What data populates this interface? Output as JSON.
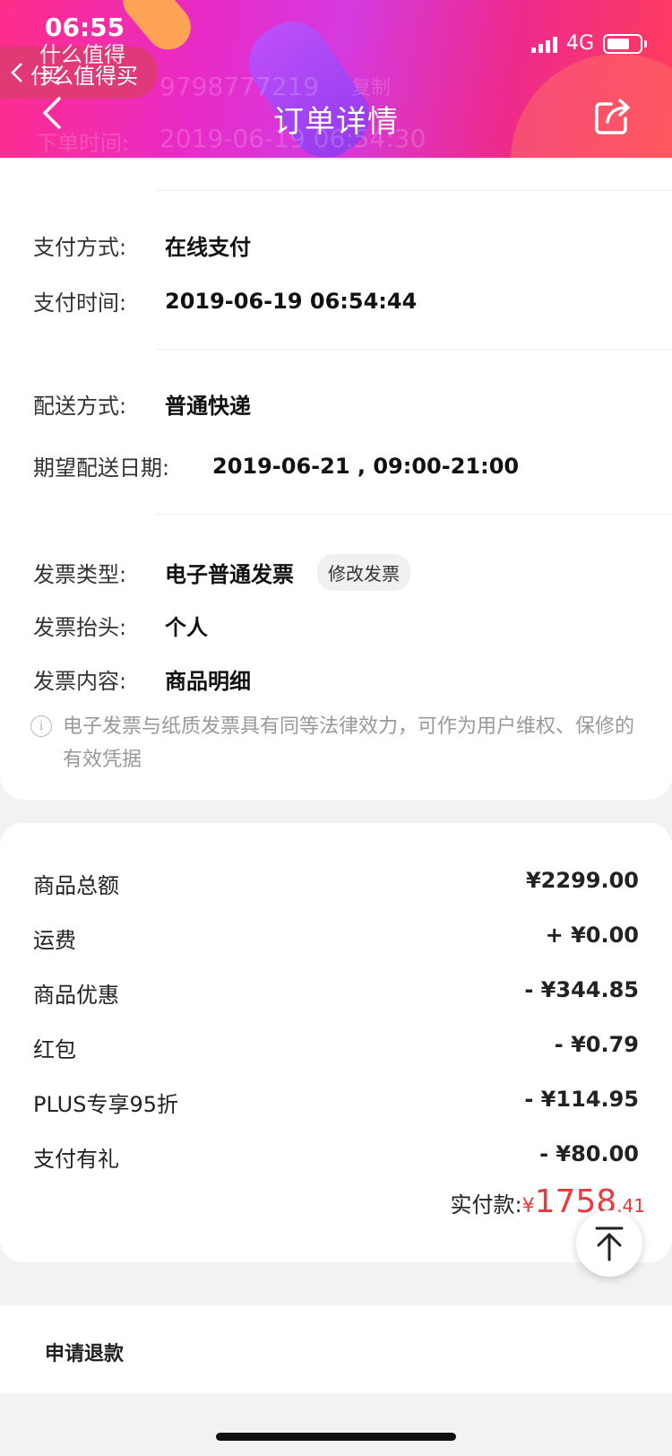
{
  "status_bar": {
    "time": "06:55",
    "network": "4G"
  },
  "app_back": {
    "label": "什么值得买"
  },
  "header": {
    "title": "订单详情",
    "ghost_order_no": "9798777219",
    "ghost_copy": "复制",
    "ghost_time_label": "下单时间:",
    "ghost_time_value": "2019-06-19 06:54:30"
  },
  "payment": {
    "method_label": "支付方式:",
    "method_value": "在线支付",
    "time_label": "支付时间:",
    "time_value": "2019-06-19 06:54:44"
  },
  "delivery": {
    "method_label": "配送方式:",
    "method_value": "普通快递",
    "date_label": "期望配送日期:",
    "date_value": "2019-06-21 , 09:00-21:00"
  },
  "invoice": {
    "type_label": "发票类型:",
    "type_value": "电子普通发票",
    "modify_label": "修改发票",
    "header_label": "发票抬头:",
    "header_value": "个人",
    "content_label": "发票内容:",
    "content_value": "商品明细",
    "note": "电子发票与纸质发票具有同等法律效力，可作为用户维权、保修的有效凭据"
  },
  "summary": {
    "rows": [
      {
        "label": "商品总额",
        "amount": "¥2299.00"
      },
      {
        "label": "运费",
        "amount": "+ ¥0.00"
      },
      {
        "label": "商品优惠",
        "amount": "- ¥344.85"
      },
      {
        "label": "红包",
        "amount": "- ¥0.79"
      },
      {
        "label": "PLUS专享95折",
        "amount": "- ¥114.95"
      },
      {
        "label": "支付有礼",
        "amount": "- ¥80.00"
      }
    ],
    "paid_label": "实付款:",
    "paid_currency": "¥",
    "paid_integer": "1758",
    "paid_decimal": ".41"
  },
  "refund": {
    "label": "申请退款"
  }
}
